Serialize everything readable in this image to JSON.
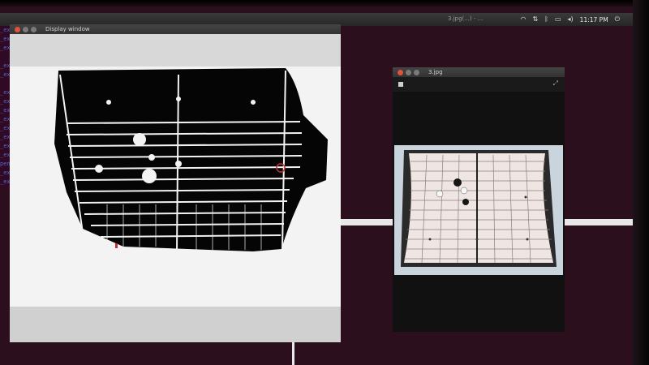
{
  "system_bar": {
    "center_title": "3.jpg(...) - ...",
    "indicators": [
      "wifi-icon",
      "transfer-icon",
      "bluetooth-icon",
      "battery-icon",
      "volume-icon"
    ],
    "clock": "11:17 PM",
    "power_icon": "power-icon"
  },
  "terminal": {
    "lines": [
      "_exa",
      "_exa",
      "_exa",
      "",
      "_exa",
      "_exa",
      "",
      "_exa",
      "_exa",
      "_exa",
      "_exa",
      "_exa",
      "_exa",
      "_exa",
      "_exa",
      "pencv",
      "_exa",
      "_exa",
      "_exa"
    ]
  },
  "display_window": {
    "title": "Display window",
    "content": "thresholded binary image of go board"
  },
  "image_window": {
    "title": "3.jpg",
    "content": "photo of go board with stones"
  },
  "colors": {
    "desktop": "#2b0f1c",
    "terminal_text": "#5a63c8",
    "close_button": "#e0533b"
  }
}
